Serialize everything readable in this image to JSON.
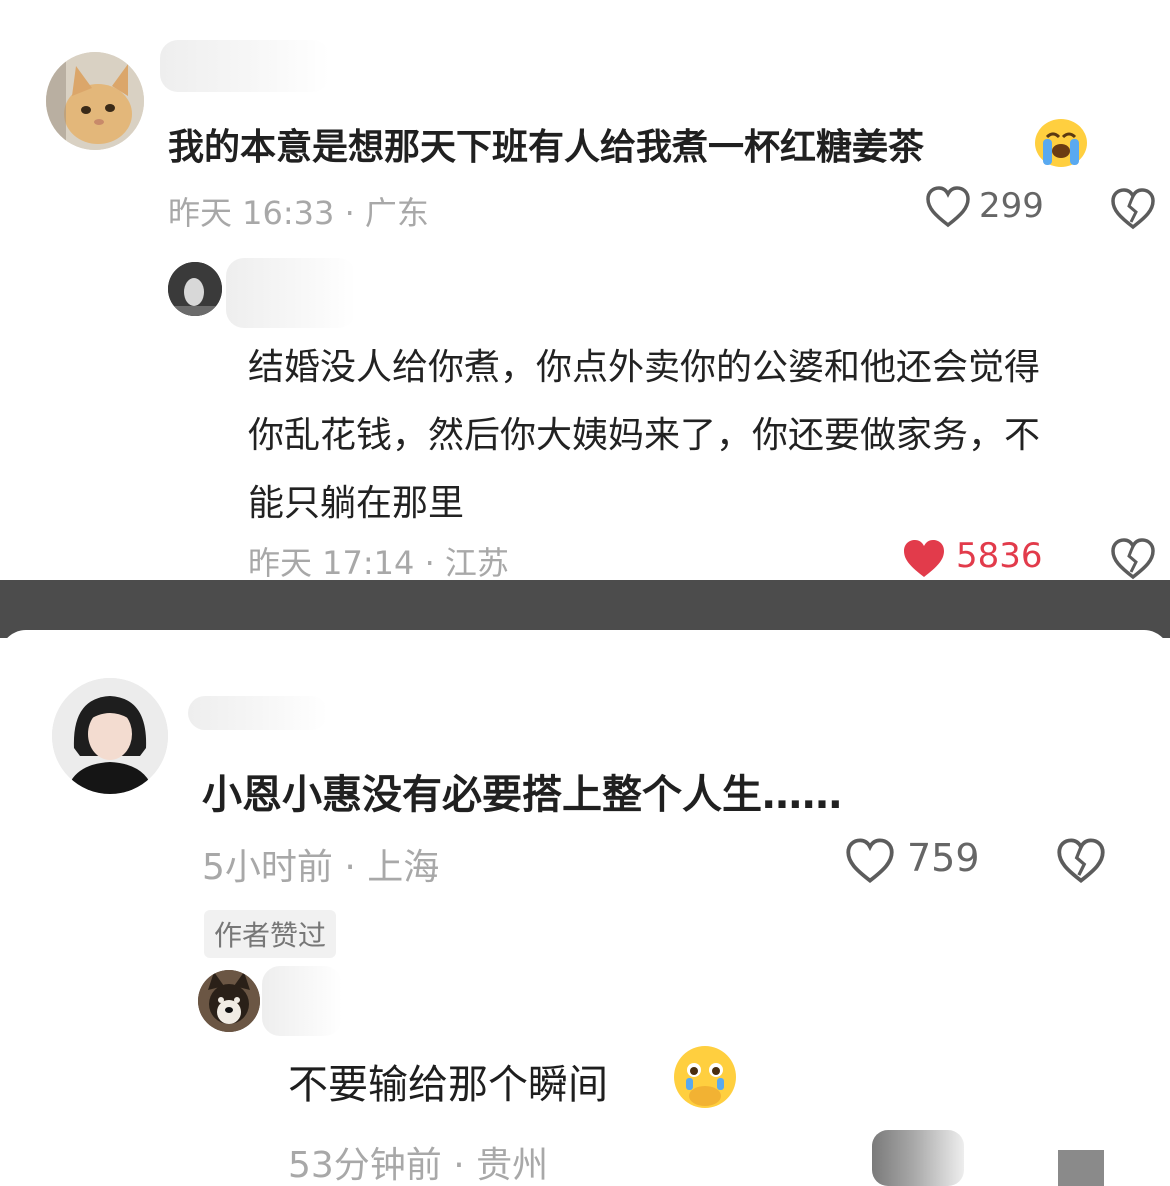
{
  "top_thread": {
    "comment": {
      "text": "我的本意是想那天下班有人给我煮一杯红糖姜茶",
      "time_location": "昨天 16:33 · 广东",
      "likes": "299",
      "emoji": "loudly-crying-face"
    },
    "reply": {
      "lines": [
        "结婚没人给你煮，你点外卖你的公婆和他还会觉得",
        "你乱花钱，然后你大姨妈来了，你还要做家务，不",
        "能只躺在那里"
      ],
      "time_location": "昨天 17:14 · 江苏",
      "likes": "5836",
      "liked": true
    }
  },
  "bottom_thread": {
    "comment": {
      "text": "小恩小惠没有必要搭上整个人生……",
      "time_location": "5小时前 · 上海",
      "likes": "759",
      "author_tag": "作者赞过"
    },
    "reply": {
      "text": "不要输给那个瞬间",
      "time_location": "53分钟前 · 贵州",
      "emoji": "face-holding-back-tears"
    }
  },
  "colors": {
    "like_active": "#e23b4b",
    "meta_text": "#a8a8a8",
    "divider": "#4c4c4c"
  },
  "icons": [
    "heart-outline-icon",
    "heart-filled-icon",
    "broken-heart-icon",
    "cat-avatar",
    "dog-avatar",
    "woman-avatar"
  ]
}
